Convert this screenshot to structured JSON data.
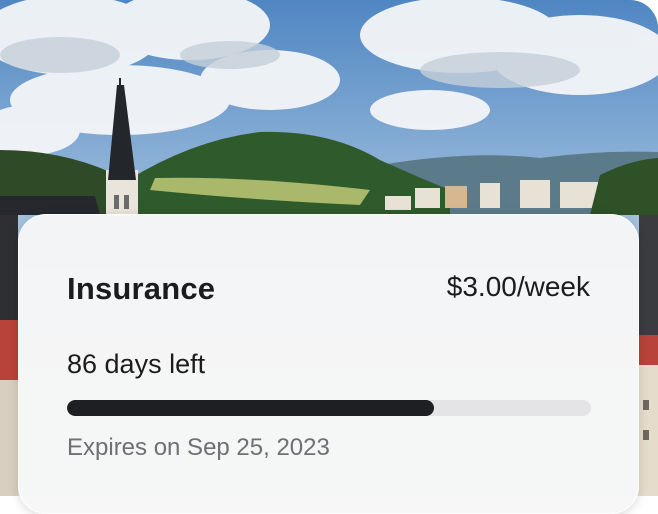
{
  "insurance": {
    "title": "Insurance",
    "price": "$3.00/week",
    "days_left": "86 days left",
    "progress_fraction": 0.7,
    "expires": "Expires on Sep 25, 2023"
  },
  "colors": {
    "progress_fill": "#1e1f22",
    "progress_track": "#e4e4e7",
    "muted_text": "#6f6f74"
  }
}
